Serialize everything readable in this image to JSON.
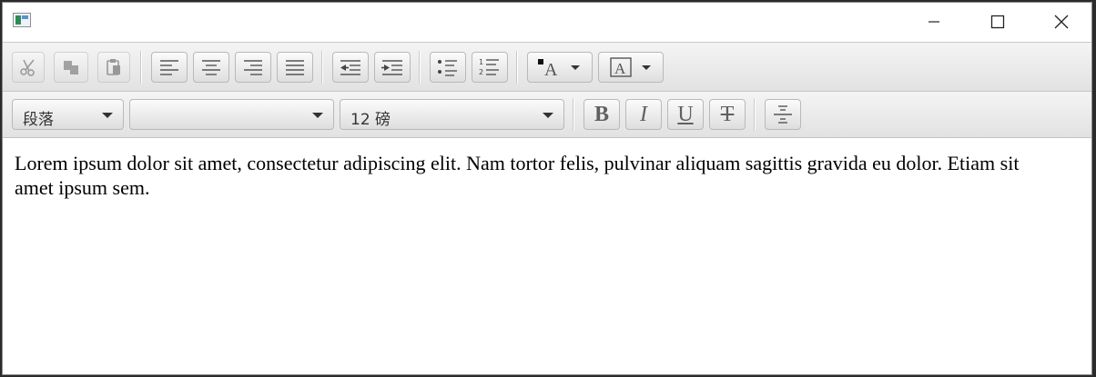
{
  "window": {
    "icon": "app-icon",
    "controls": [
      "minimize-icon",
      "maximize-icon",
      "close-icon"
    ]
  },
  "toolbar_top": {
    "buttons": [
      {
        "name": "cut",
        "icon": "scissors-icon",
        "enabled": false
      },
      {
        "name": "copy",
        "icon": "copy-icon",
        "enabled": false
      },
      {
        "name": "paste",
        "icon": "clipboard-icon",
        "enabled": false
      },
      {
        "name": "align-left",
        "icon": "align-left-icon",
        "enabled": true
      },
      {
        "name": "align-center",
        "icon": "align-center-icon",
        "enabled": true
      },
      {
        "name": "align-right",
        "icon": "align-right-icon",
        "enabled": true
      },
      {
        "name": "align-justify",
        "icon": "align-justify-icon",
        "enabled": true
      },
      {
        "name": "outdent",
        "icon": "outdent-icon",
        "enabled": true
      },
      {
        "name": "indent",
        "icon": "indent-icon",
        "enabled": true
      },
      {
        "name": "bullet-list",
        "icon": "bullet-list-icon",
        "enabled": true
      },
      {
        "name": "numbered-list",
        "icon": "numbered-list-icon",
        "enabled": true
      },
      {
        "name": "text-color",
        "icon": "text-color-icon",
        "enabled": true
      },
      {
        "name": "highlight-color",
        "icon": "highlight-color-icon",
        "enabled": true
      }
    ]
  },
  "toolbar_format": {
    "paragraph_style": "段落",
    "font_family": "",
    "font_size": "12 磅",
    "bold_label": "B",
    "italic_label": "I",
    "underline_label": "U",
    "strike_label": "T"
  },
  "editor": {
    "content": "Lorem ipsum dolor sit amet, consectetur adipiscing elit. Nam tortor felis, pulvinar aliquam sagittis gravida eu dolor. Etiam sit amet ipsum sem."
  },
  "colors": {
    "toolbar_top": "#f4f4f4",
    "toolbar_bottom": "#e2e2e2",
    "icon": "#555555",
    "text": "#000000"
  }
}
